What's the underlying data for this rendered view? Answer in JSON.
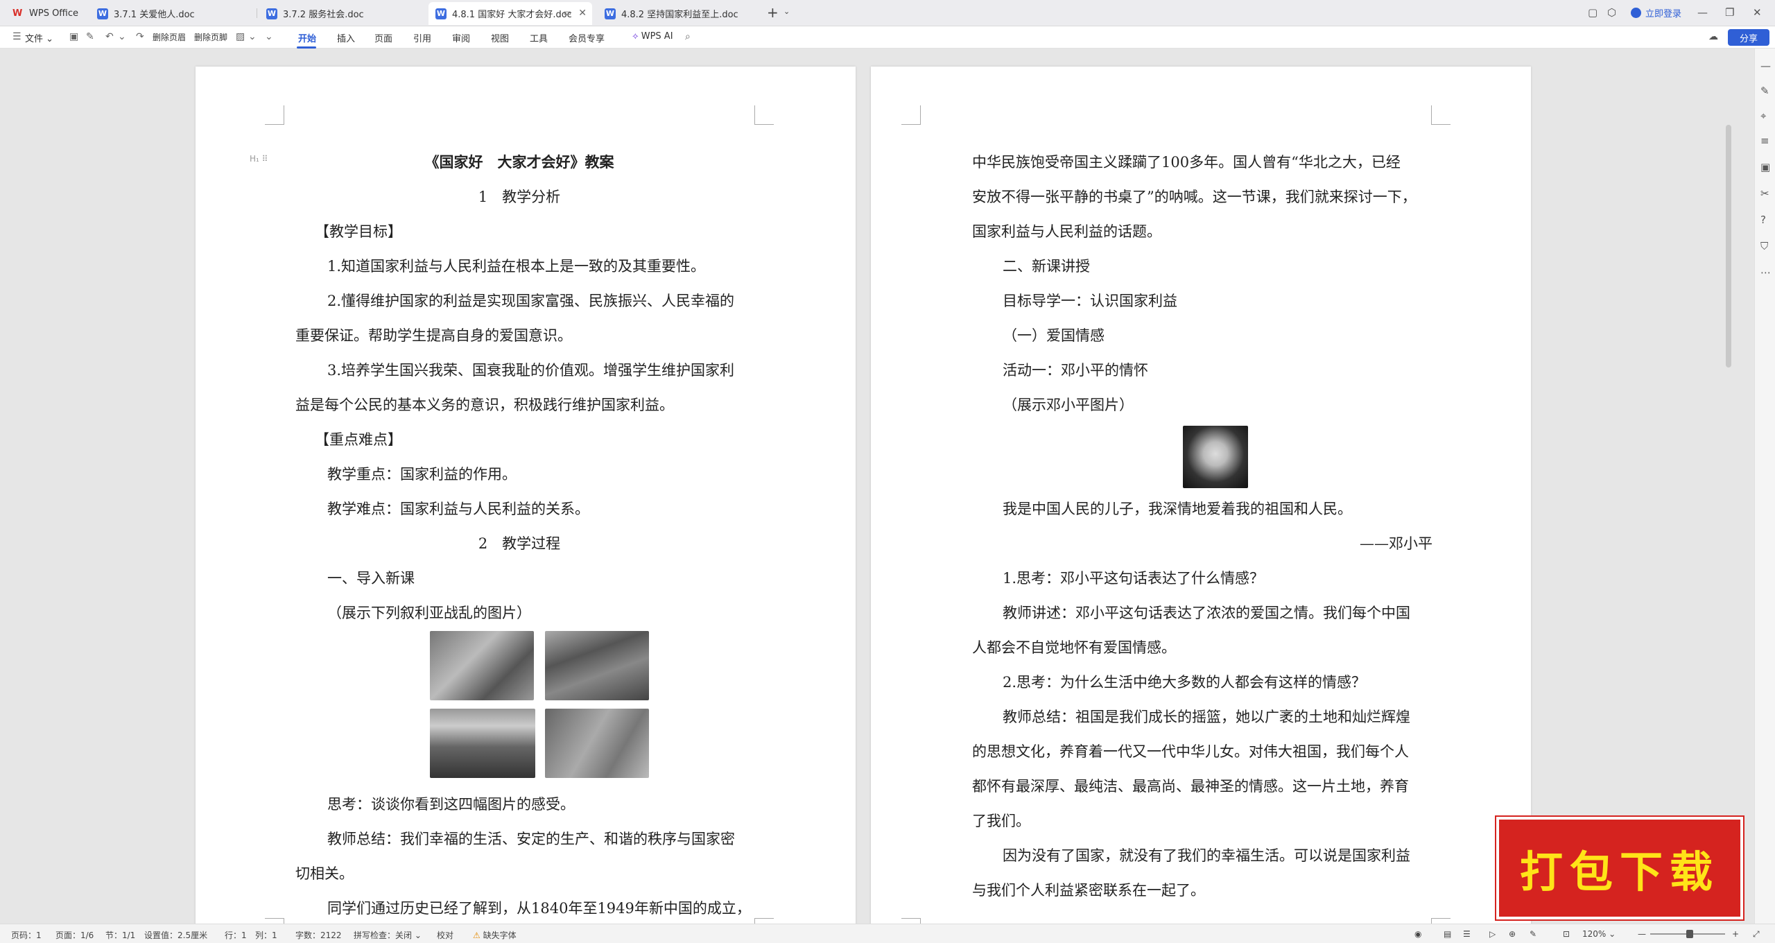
{
  "tabs": [
    {
      "label": "WPS Office"
    },
    {
      "label": "3.7.1 关爱他人.doc"
    },
    {
      "label": "3.7.2 服务社会.doc"
    },
    {
      "label": "4.8.1 国家好 大家才会好.doc"
    },
    {
      "label": "4.8.2 坚持国家利益至上.doc"
    }
  ],
  "login_label": "立即登录",
  "share_label": "分享",
  "ribbon": {
    "file": "文件",
    "delete_header": "删除页眉",
    "delete_footer": "删除页脚",
    "menus": [
      "开始",
      "插入",
      "页面",
      "引用",
      "审阅",
      "视图",
      "工具",
      "会员专享"
    ],
    "wps_ai": "WPS AI"
  },
  "page_left": {
    "lines": [
      "《国家好　大家才会好》教案",
      "1　教学分析",
      "【教学目标】",
      "1.知道国家利益与人民利益在根本上是一致的及其重要性。",
      "2.懂得维护国家的利益是实现国家富强、民族振兴、人民幸福的",
      "重要保证。帮助学生提高自身的爱国意识。",
      "3.培养学生国兴我荣、国衰我耻的价值观。增强学生维护国家利",
      "益是每个公民的基本义务的意识，积极践行维护国家利益。",
      "【重点难点】",
      "教学重点：国家利益的作用。",
      "教学难点：国家利益与人民利益的关系。",
      "2　教学过程",
      "一、导入新课",
      "（展示下列叙利亚战乱的图片）",
      "思考：谈谈你看到这四幅图片的感受。",
      "教师总结：我们幸福的生活、安定的生产、和谐的秩序与国家密",
      "切相关。",
      "同学们通过历史已经了解到，从1840年至1949年新中国的成立，"
    ]
  },
  "page_right": {
    "lines": [
      "中华民族饱受帝国主义蹂躏了100多年。国人曾有“华北之大，已经",
      "安放不得一张平静的书桌了”的呐喊。这一节课，我们就来探讨一下，",
      "国家利益与人民利益的话题。",
      "二、新课讲授",
      "目标导学一：认识国家利益",
      "（一）爱国情感",
      "活动一：邓小平的情怀",
      "（展示邓小平图片）",
      "我是中国人民的儿子，我深情地爱着我的祖国和人民。",
      "——邓小平",
      "1.思考：邓小平这句话表达了什么情感？",
      "教师讲述：邓小平这句话表达了浓浓的爱国之情。我们每个中国",
      "人都会不自觉地怀有爱国情感。",
      "2.思考：为什么生活中绝大多数的人都会有这样的情感？",
      "教师总结：祖国是我们成长的摇篮，她以广袤的土地和灿烂辉煌",
      "的思想文化，养育着一代又一代中华儿女。对伟大祖国，我们每个人",
      "都怀有最深厚、最纯洁、最高尚、最神圣的情感。这一片土地，养育",
      "了我们。",
      "因为没有了国家，就没有了我们的幸福生活。可以说是国家利益",
      "与我们个人利益紧密联系在一起了。"
    ]
  },
  "status": {
    "page_code": "页码：1",
    "page": "页面：1/6",
    "section": "节：1/1",
    "setting": "设置值：2.5厘米",
    "row": "行：1",
    "col": "列：1",
    "words": "字数：2122",
    "spell": "拼写检查：关闭",
    "proof": "校对",
    "missing_font": "缺失字体",
    "zoom": "120%"
  },
  "badge_text": "打包下载",
  "colors": {
    "accent": "#2f5fd6",
    "badge": "#d5231f",
    "badge_text": "#ffe418"
  }
}
